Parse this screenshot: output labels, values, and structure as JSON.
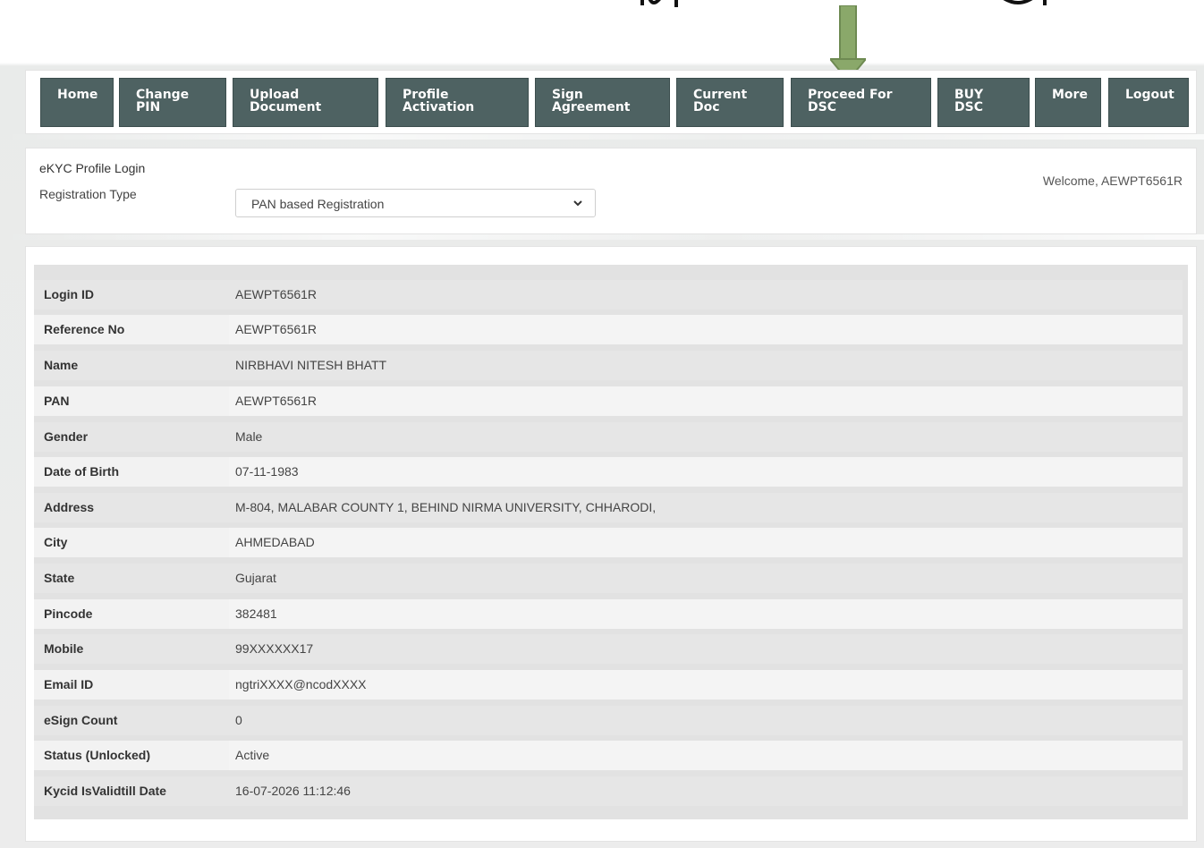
{
  "nav": {
    "buttons": [
      {
        "label": "Home"
      },
      {
        "label": "Change\nPIN"
      },
      {
        "label": "Upload\nDocument"
      },
      {
        "label": "Profile\nActivation"
      },
      {
        "label": "Sign\nAgreement"
      },
      {
        "label": "Current\nDoc"
      },
      {
        "label": "Proceed For\nDSC"
      },
      {
        "label": "BUY\nDSC"
      },
      {
        "label": "More"
      },
      {
        "label": "Logout"
      }
    ]
  },
  "form": {
    "title": "eKYC Profile Login",
    "registration_label": "Registration Type",
    "registration_value": "PAN based Registration",
    "welcome": "Welcome, AEWPT6561R"
  },
  "details": {
    "rows": [
      {
        "label": "Login ID",
        "value": "AEWPT6561R"
      },
      {
        "label": "Reference No",
        "value": "AEWPT6561R"
      },
      {
        "label": "Name",
        "value": "NIRBHAVI NITESH BHATT"
      },
      {
        "label": "PAN",
        "value": "AEWPT6561R"
      },
      {
        "label": "Gender",
        "value": "Male"
      },
      {
        "label": "Date of Birth",
        "value": "07-11-1983"
      },
      {
        "label": "Address",
        "value": "M-804, MALABAR COUNTY 1, BEHIND NIRMA UNIVERSITY, CHHARODI,"
      },
      {
        "label": "City",
        "value": "AHMEDABAD"
      },
      {
        "label": "State",
        "value": "Gujarat"
      },
      {
        "label": "Pincode",
        "value": "382481"
      },
      {
        "label": "Mobile",
        "value": "99XXXXXX17"
      },
      {
        "label": "Email ID",
        "value": "ngtriXXXX@ncodXXXX"
      },
      {
        "label": "eSign Count",
        "value": "0"
      },
      {
        "label": "Status (Unlocked)",
        "value": "Active"
      },
      {
        "label": "Kycid IsValidtill Date",
        "value": "16-07-2026 11:12:46"
      }
    ]
  },
  "colors": {
    "nav_button": "#4e6262",
    "arrow": "#8aa86a"
  },
  "icons": {
    "select_chevron": "chevron-down-icon",
    "pointer_arrow": "down-arrow-icon"
  }
}
